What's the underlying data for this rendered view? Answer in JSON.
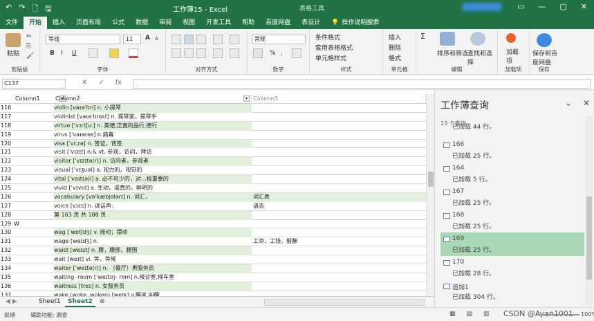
{
  "titlebar": {
    "title": "工作簿15 - Excel",
    "context_tab": "表格工具",
    "quick_access": [
      "↶",
      "↷",
      "🗋",
      "🖫"
    ],
    "window_buttons": [
      "▭",
      "—",
      "▢",
      "✕"
    ]
  },
  "tabs": [
    "文件",
    "开始",
    "插入",
    "页面布局",
    "公式",
    "数据",
    "审阅",
    "视图",
    "开发工具",
    "帮助",
    "百度网盘",
    "表设计"
  ],
  "active_tab": "开始",
  "tell_me": "操作说明搜索",
  "ribbon": {
    "clipboard": {
      "paste": "粘贴",
      "label": "剪贴板"
    },
    "font": {
      "family": "等线",
      "size": "11",
      "bold": "B",
      "italic": "I",
      "underline": "U",
      "grow": "A",
      "shrink": "A",
      "label": "字体"
    },
    "alignment": {
      "label": "对齐方式"
    },
    "number": {
      "format": "常规",
      "percent": "%",
      "comma": ",",
      "label": "数字"
    },
    "styles": {
      "conditional": "条件格式",
      "as_table": "套用表格格式",
      "cell_styles": "单元格样式",
      "label": "样式"
    },
    "cells": {
      "insert": "插入",
      "delete": "删除",
      "format": "格式",
      "label": "单元格"
    },
    "editing": {
      "sort": "排序和筛选",
      "find": "查找和选择",
      "label": "编辑"
    },
    "addins": {
      "add": "加载项",
      "label": "加载项"
    },
    "baidu": {
      "save": "保存到百度网盘",
      "label": "保存"
    }
  },
  "formula_bar": {
    "name_box": "C137",
    "icons": [
      "✕",
      "✓",
      "fx"
    ],
    "formula": ""
  },
  "columns": [
    "Column1",
    "Column2",
    "Column3"
  ],
  "rows": [
    {
      "n": "116",
      "c1": "",
      "c2": "violin [vaɪəˈlɪn] n. 小提琴",
      "c3": ""
    },
    {
      "n": "117",
      "c1": "",
      "c2": "violinist [vaɪəˈlɪnɪst] n. 提琴家，提琴手",
      "c3": ""
    },
    {
      "n": "118",
      "c1": "",
      "c2": "virtue [ˈvɜːtʃuː] n. 美德,正直的品行,德行",
      "c3": ""
    },
    {
      "n": "119",
      "c1": "",
      "c2": "virus [ˈvaɪərəs] n.病毒",
      "c3": ""
    },
    {
      "n": "120",
      "c1": "",
      "c2": "visa [ˈviːzə] n. 签证，背签",
      "c3": ""
    },
    {
      "n": "121",
      "c1": "",
      "c2": "visit [ˈvɪzɪt] n.& vt. 参观，访问，拜访",
      "c3": ""
    },
    {
      "n": "122",
      "c1": "",
      "c2": "visitor [ˈvɪzɪtə(r)] n. 访问者，参观者",
      "c3": ""
    },
    {
      "n": "123",
      "c1": "",
      "c2": "visual [ˈvɪʒuəl] a. 视力的，视觉的",
      "c3": ""
    },
    {
      "n": "124",
      "c1": "",
      "c2": "vital [ˈvaɪt(ə)l] a. 必不可少的，对…极重要的",
      "c3": ""
    },
    {
      "n": "125",
      "c1": "",
      "c2": "vivid [ˈvɪvɪd] a. 生动，逼真的，鲜明的",
      "c3": ""
    },
    {
      "n": "126",
      "c1": "",
      "c2": "vocabulary [vəˈkæbjʊlərɪ] n. 词汇，",
      "c3": "词汇表"
    },
    {
      "n": "127",
      "c1": "",
      "c2": "voice [vɔɪs] n. 说话声;",
      "c3": "语态"
    },
    {
      "n": "128",
      "c1": "",
      "c2": "第 163 页 共 188 页",
      "c3": ""
    },
    {
      "n": "129",
      "c1": "W",
      "c2": "",
      "c3": ""
    },
    {
      "n": "130",
      "c1": "",
      "c2": "wag [ˈwɒtʃdʒ] v. 摇动；摆动",
      "c3": ""
    },
    {
      "n": "131",
      "c1": "",
      "c2": "wage [weɪdʒ] n.",
      "c3": "工资，工钱，报酬"
    },
    {
      "n": "132",
      "c1": "",
      "c2": "waist [weɪst] n. 腰，腰部，腰围",
      "c3": ""
    },
    {
      "n": "133",
      "c1": "",
      "c2": "wait [weɪt] vi. 等，等候",
      "c3": ""
    },
    {
      "n": "134",
      "c1": "",
      "c2": "waiter [ˈweɪtə(r)] n. （餐厅）男服务员",
      "c3": ""
    },
    {
      "n": "135",
      "c1": "",
      "c2": "waiting -room [ˈweɪtɪŋ- rʊm] n.候诊室,候车室",
      "c3": ""
    },
    {
      "n": "136",
      "c1": "",
      "c2": "waitress [tres] n. 女服务员",
      "c3": ""
    },
    {
      "n": "137",
      "c1": "",
      "c2": "wake (woke, woken) [weɪk] v.醒来,叫醒",
      "c3": ""
    }
  ],
  "sheets": [
    "Sheet1",
    "Sheet2"
  ],
  "active_sheet": "Sheet2",
  "pane": {
    "title": "工作薄查询",
    "count": "13 个查询",
    "items": [
      {
        "name": "",
        "status": "已加载 44 行。"
      },
      {
        "name": "166",
        "status": "已加载 25 行。"
      },
      {
        "name": "164",
        "status": "已加载 5 行。"
      },
      {
        "name": "167",
        "status": "已加载 25 行。"
      },
      {
        "name": "168",
        "status": "已加载 25 行。"
      },
      {
        "name": "169",
        "status": "已加载 25 行。"
      },
      {
        "name": "170",
        "status": "已加载 28 行。"
      },
      {
        "name": "追加1",
        "status": "已加载 304 行。"
      }
    ],
    "highlighted": "169"
  },
  "status": {
    "ready": "就绪",
    "accessibility": "辅助功能: 调查",
    "zoom": "100%",
    "watermark": "CSDN @Ayan1001"
  },
  "colors": {
    "accent": "#217346",
    "band": "#e2efda",
    "highlight": "#a8d8b6"
  }
}
